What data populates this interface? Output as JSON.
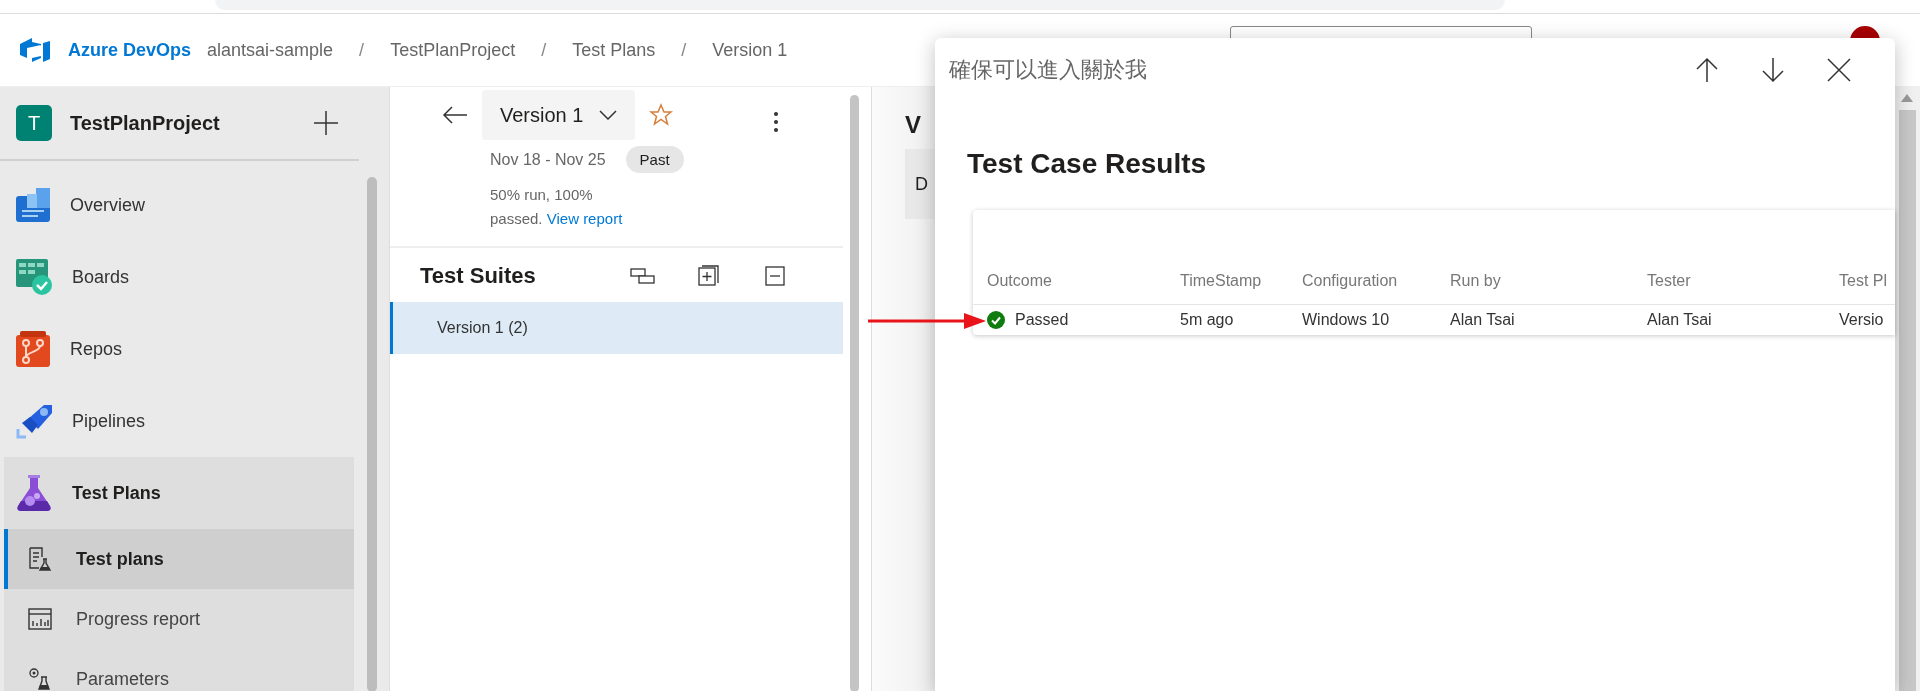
{
  "header": {
    "brand": "Azure DevOps",
    "breadcrumbs": [
      {
        "label": "alantsai-sample",
        "separator": "/"
      },
      {
        "label": "TestPlanProject",
        "separator": "/"
      },
      {
        "label": "Test Plans",
        "separator": "/"
      },
      {
        "label": "Version 1"
      }
    ]
  },
  "sidebar": {
    "project": {
      "initial": "T",
      "name": "TestPlanProject"
    },
    "items": [
      {
        "label": "Overview",
        "selected": false
      },
      {
        "label": "Boards",
        "selected": false
      },
      {
        "label": "Repos",
        "selected": false
      },
      {
        "label": "Pipelines",
        "selected": false
      },
      {
        "label": "Test Plans",
        "selected": true,
        "children": [
          {
            "label": "Test plans",
            "selected": true
          },
          {
            "label": "Progress report",
            "selected": false
          },
          {
            "label": "Parameters",
            "selected": false
          }
        ]
      }
    ]
  },
  "plan": {
    "title": "Version 1",
    "favorite": false,
    "dates": "Nov 18 - Nov 25",
    "status": "Past",
    "summary": "50% run, 100% passed.",
    "link": "View report"
  },
  "suites": {
    "title": "Test Suites",
    "items": [
      {
        "label": "Version 1 (2)",
        "selected": true
      }
    ]
  },
  "behind": {
    "title": "V",
    "tab": "D"
  },
  "dialog": {
    "title": "確保可以進入關於我",
    "heading": "Test Case Results",
    "columns": [
      "Outcome",
      "TimeStamp",
      "Configuration",
      "Run by",
      "Tester",
      "Test Pl"
    ],
    "rows": [
      {
        "passed": true,
        "cells": [
          "Passed",
          "5m ago",
          "Windows 10",
          "Alan Tsai",
          "Alan Tsai",
          "Versio"
        ]
      }
    ]
  }
}
